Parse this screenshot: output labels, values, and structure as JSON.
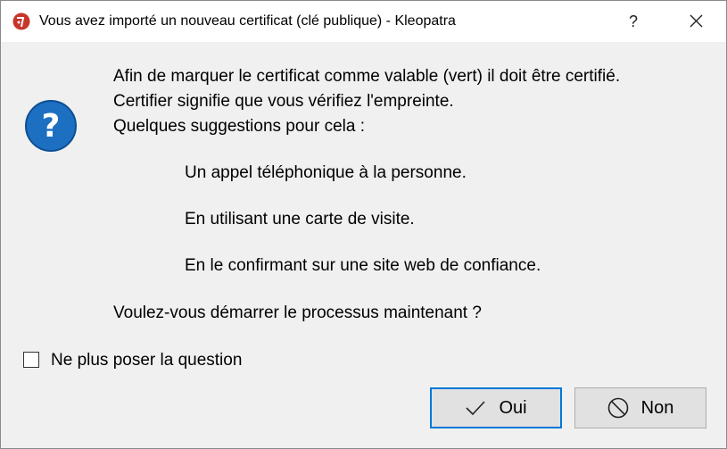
{
  "window": {
    "title": "Vous avez importé un nouveau certificat (clé publique) - Kleopatra",
    "help_label": "?",
    "app_icon": "kleopatra-icon",
    "close_icon": "close-icon"
  },
  "message": {
    "icon": "question-icon",
    "line1": "Afin de marquer le certificat comme valable (vert) il doit être certifié.",
    "line2": "Certifier signifie que vous vérifiez l'empreinte.",
    "line3": "Quelques suggestions pour cela :",
    "suggestions": [
      "Un appel téléphonique à la personne.",
      "En utilisant une carte de visite.",
      "En le confirmant sur une site web de confiance."
    ],
    "question": "Voulez-vous démarrer le processus maintenant ?"
  },
  "checkbox": {
    "label": "Ne plus poser la question",
    "checked": false
  },
  "buttons": {
    "yes_label": "Oui",
    "yes_icon": "checkmark-icon",
    "no_label": "Non",
    "no_icon": "no-entry-icon"
  },
  "colors": {
    "accent": "#0078d7",
    "app_icon_red": "#c8352b",
    "question_blue": "#1d6fc1"
  }
}
